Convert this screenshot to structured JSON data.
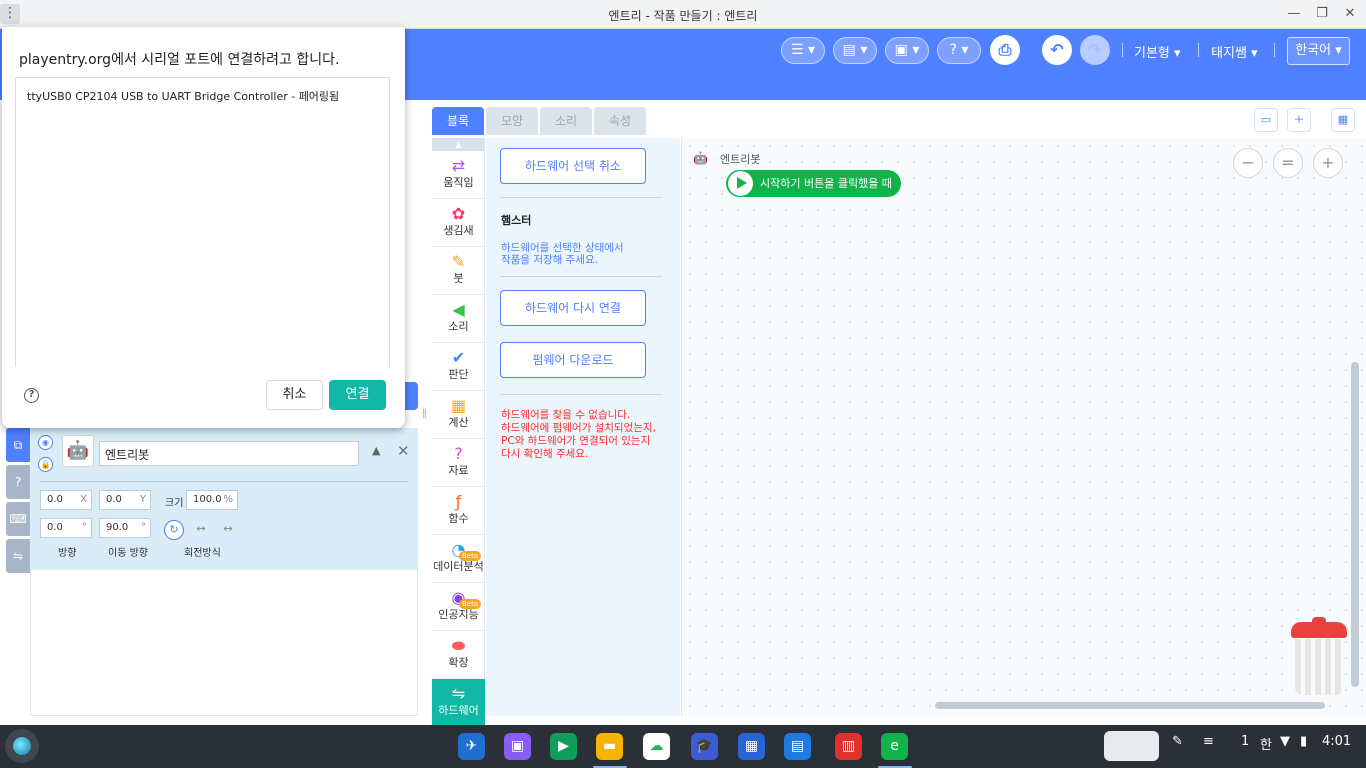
{
  "window": {
    "title": "엔트리 - 작품 만들기 : 엔트리",
    "menu_glyph": "⋮",
    "minimize": "—",
    "restore": "❐",
    "close": "✕"
  },
  "header": {
    "mode_label": "기본형",
    "teacher_label": "태지쌤",
    "language_label": "한국어",
    "caret": "▾",
    "icons": [
      "block-mode-icon",
      "file-icon",
      "save-icon",
      "help-icon",
      "print-icon",
      "undo-icon",
      "redo-icon"
    ],
    "help_glyph": "?",
    "print_glyph": "⎙",
    "undo_glyph": "↶",
    "redo_glyph": "↷",
    "accent_color": "#4f80ff"
  },
  "dialog": {
    "title": "playentry.org에서 시리얼 포트에 연결하려고 합니다.",
    "devices": [
      "ttyUSB0 CP2104 USB to UART Bridge Controller - 페어링됨"
    ],
    "help_glyph": "?",
    "cancel_label": "취소",
    "connect_label": "연결",
    "connect_color": "#12b8a6"
  },
  "block_tabs": [
    "블록",
    "모양",
    "소리",
    "속성"
  ],
  "categories": [
    {
      "label": "움직임",
      "icon": "move-icon",
      "glyph": "⇄",
      "color": "#a45cff"
    },
    {
      "label": "생김새",
      "icon": "looks-icon",
      "glyph": "✿",
      "color": "#ff3a6b"
    },
    {
      "label": "붓",
      "icon": "brush-icon",
      "glyph": "✎",
      "color": "#ff9b1e"
    },
    {
      "label": "소리",
      "icon": "sound-icon",
      "glyph": "◀",
      "color": "#36c446"
    },
    {
      "label": "판단",
      "icon": "judge-icon",
      "glyph": "✔",
      "color": "#4f80ff"
    },
    {
      "label": "계산",
      "icon": "calc-icon",
      "glyph": "▦",
      "color": "#f5a623"
    },
    {
      "label": "자료",
      "icon": "data-icon",
      "glyph": "?",
      "color": "#d84ad6"
    },
    {
      "label": "함수",
      "icon": "function-icon",
      "glyph": "ƒ",
      "color": "#ff6a1e"
    },
    {
      "label": "데이터분석",
      "icon": "analysis-icon",
      "glyph": "◔",
      "color": "#2aa4f4",
      "beta": "Beta"
    },
    {
      "label": "인공지능",
      "icon": "ai-icon",
      "glyph": "◉",
      "color": "#8c3cf0",
      "beta": "Beta"
    },
    {
      "label": "확장",
      "icon": "extension-icon",
      "glyph": "⬬",
      "color": "#ff5a5a"
    },
    {
      "label": "하드웨어",
      "icon": "hardware-icon",
      "glyph": "⇋",
      "color": "#ffffff",
      "active": true
    }
  ],
  "palette": {
    "cancel_hw_label": "하드웨어 선택 취소",
    "hw_name": "햄스터",
    "save_note_line1": "하드웨어를 선택한 상태에서",
    "save_note_line2": "작품을 저장해 주세요.",
    "reconnect_label": "하드웨어 다시 연결",
    "firmware_label": "펌웨어 다운로드",
    "error_line1": "하드웨어를 찾을 수 없습니다.",
    "error_line2": "하드웨어에 펌웨어가 설치되었는지,",
    "error_line3": "PC와 하드웨어가 연결되어 있는지",
    "error_line4": "다시 확인해 주세요.",
    "error_color": "#ff2a2a"
  },
  "workspace": {
    "object_label": "엔트리봇",
    "start_block_label": "시작하기 버튼을 클릭했을 때",
    "zoom_out": "−",
    "zoom_reset": "=",
    "zoom_in": "+",
    "start_block_color": "#12b34a"
  },
  "object": {
    "name": "엔트리봇",
    "x_value": "0.0",
    "x_unit": "X",
    "y_value": "0.0",
    "y_unit": "Y",
    "size_label": "크기",
    "size_value": "100.0",
    "size_unit": "%",
    "direction_value": "0.0",
    "direction_unit": "°",
    "move_direction_value": "90.0",
    "move_direction_unit": "°",
    "direction_label": "방향",
    "move_direction_label": "이동 방향",
    "rotation_label": "회전방식"
  },
  "taskbar": {
    "apps": [
      "feather-app-icon",
      "store-app-icon",
      "meet-app-icon",
      "files-app-icon",
      "cloud-app-icon",
      "classroom-app-icon",
      "whiteboard-app-icon",
      "reader-app-icon",
      "calendar-app-icon",
      "entry-app-icon"
    ],
    "notification_count": "1",
    "ime_label": "한",
    "clock": "4:01"
  }
}
